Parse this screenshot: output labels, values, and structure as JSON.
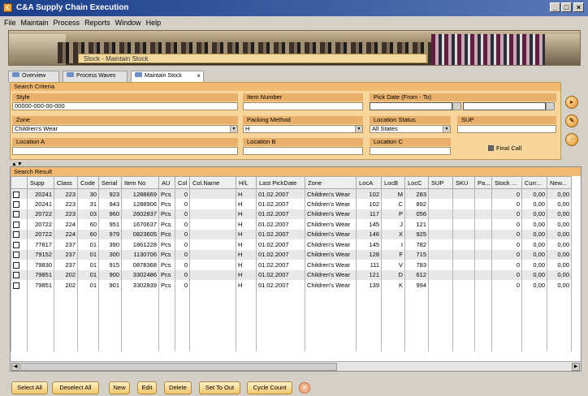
{
  "window": {
    "title": "C&A Supply Chain Execution",
    "minimize": "_",
    "maximize": "□",
    "close": "×"
  },
  "menu": [
    "File",
    "Maintain",
    "Process",
    "Reports",
    "Window",
    "Help"
  ],
  "banner": {
    "label": "Stock - Maintain Stock"
  },
  "tabs": [
    {
      "label": "Overview"
    },
    {
      "label": "Process Waves"
    },
    {
      "label": "Maintain Stock",
      "close": "×"
    }
  ],
  "search_criteria": {
    "header": "Search Criteria",
    "style": {
      "label": "Style",
      "value": "00000-000-00-000"
    },
    "item_number": {
      "label": "Item Number",
      "value": ""
    },
    "pick_date": {
      "label": "Pick Date (From - To)"
    },
    "zone": {
      "label": "Zone",
      "value": "Children's Wear"
    },
    "packing_method": {
      "label": "Packing Method",
      "value": "H"
    },
    "location_status": {
      "label": "Location Status",
      "value": "All States"
    },
    "sup": {
      "label": "SUP",
      "value": ""
    },
    "location_a": {
      "label": "Location A",
      "value": ""
    },
    "location_b": {
      "label": "Location B",
      "value": ""
    },
    "location_c": {
      "label": "Location C",
      "value": ""
    },
    "final_call": {
      "label": "Final Call",
      "checked": true
    }
  },
  "search_result": {
    "header": "Search Result",
    "columns": [
      "",
      "Supp",
      "Class",
      "Code",
      "Serial",
      "Item No",
      "AU",
      "Col",
      "Col.Name",
      "H/L",
      "Last PickDate",
      "Zone",
      "LocA",
      "LocB",
      "LocC",
      "SUP",
      "SKU",
      "Pa...",
      "Stock ...",
      "Curr...",
      "New..."
    ],
    "rows": [
      [
        "",
        "20241",
        "223",
        "30",
        "923",
        "1288669",
        "Pcs",
        "0",
        "",
        "H",
        "01.02.2007",
        "Children's Wear",
        "102",
        "M",
        "283",
        "",
        "",
        "",
        "0",
        "0,00",
        "0,00"
      ],
      [
        "",
        "20241",
        "223",
        "31",
        "943",
        "1288906",
        "Pcs",
        "0",
        "",
        "H",
        "01.02.2007",
        "Children's Wear",
        "102",
        "C",
        "892",
        "",
        "",
        "",
        "0",
        "0,00",
        "0,00"
      ],
      [
        "",
        "20722",
        "223",
        "03",
        "960",
        "2602837",
        "Pcs",
        "0",
        "",
        "H",
        "01.02.2007",
        "Children's Wear",
        "117",
        "P",
        "056",
        "",
        "",
        "",
        "0",
        "0,00",
        "0,00"
      ],
      [
        "",
        "20722",
        "224",
        "60",
        "951",
        "1670637",
        "Pcs",
        "0",
        "",
        "H",
        "01.02.2007",
        "Children's Wear",
        "145",
        "J",
        "121",
        "",
        "",
        "",
        "0",
        "0,00",
        "0,00"
      ],
      [
        "",
        "20722",
        "224",
        "60",
        "979",
        "0823605",
        "Pcs",
        "0",
        "",
        "H",
        "01.02.2007",
        "Children's Wear",
        "146",
        "X",
        "925",
        "",
        "",
        "",
        "0",
        "0,00",
        "0,00"
      ],
      [
        "",
        "77817",
        "237",
        "01",
        "390",
        "1861228",
        "Pcs",
        "0",
        "",
        "H",
        "01.02.2007",
        "Children's Wear",
        "145",
        "I",
        "782",
        "",
        "",
        "",
        "0",
        "0,00",
        "0,00"
      ],
      [
        "",
        "79152",
        "237",
        "01",
        "300",
        "1130706",
        "Pcs",
        "0",
        "",
        "H",
        "01.02.2007",
        "Children's Wear",
        "128",
        "F",
        "715",
        "",
        "",
        "",
        "0",
        "0,00",
        "0,00"
      ],
      [
        "",
        "79830",
        "237",
        "01",
        "915",
        "0878368",
        "Pcs",
        "0",
        "",
        "H",
        "01.02.2007",
        "Children's Wear",
        "111",
        "V",
        "783",
        "",
        "",
        "",
        "0",
        "0,00",
        "0,00"
      ],
      [
        "",
        "79851",
        "202",
        "01",
        "900",
        "3302486",
        "Pcs",
        "0",
        "",
        "H",
        "01.02.2007",
        "Children's Wear",
        "121",
        "D",
        "612",
        "",
        "",
        "",
        "0",
        "0,00",
        "0,00"
      ],
      [
        "",
        "79851",
        "202",
        "01",
        "901",
        "3302839",
        "Pcs",
        "0",
        "",
        "H",
        "01.02.2007",
        "Children's Wear",
        "139",
        "K",
        "994",
        "",
        "",
        "",
        "0",
        "0,00",
        "0,00"
      ]
    ]
  },
  "buttons": [
    "Select All",
    "Deselect All",
    "New",
    "Edit",
    "Delete",
    "Set To Out",
    "Cycle Count"
  ],
  "colors": {
    "criteria_bg": "#f8d69b",
    "header_orange": "#f1b970",
    "title_blue": "#1c3f8c"
  }
}
